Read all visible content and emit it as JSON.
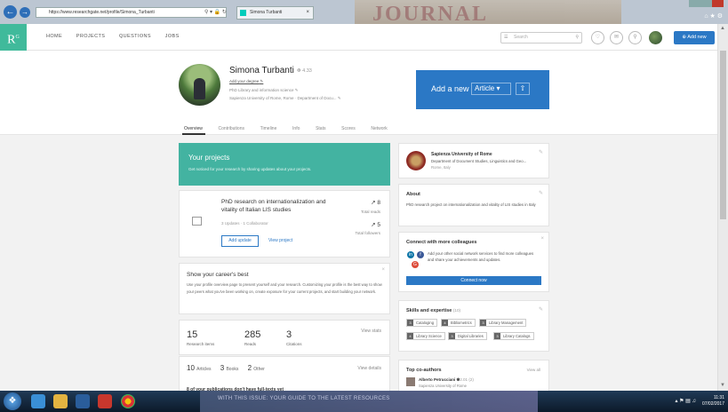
{
  "browser": {
    "url": "https://www.researchgate.net/profile/Simona_Turbanti",
    "tab_title": "Simona Turbanti",
    "background_text": "JOURNAL"
  },
  "header": {
    "logo": "R",
    "logo_sup": "G",
    "nav": [
      "HOME",
      "PROJECTS",
      "QUESTIONS",
      "JOBS"
    ],
    "search_placeholder": "Search",
    "add_new": "Add new"
  },
  "profile": {
    "name": "Simona Turbanti",
    "score": "4.33",
    "degree": "Add your degree",
    "line1": "PhD Library and information science",
    "line2": "Sapienza University of Rome, Rome · Department of Docu..."
  },
  "add_panel": {
    "label": "Add a new",
    "select": "Article"
  },
  "tabs": [
    "Overview",
    "Contributions",
    "Timeline",
    "Info",
    "Stats",
    "Scores",
    "Network"
  ],
  "projects_card": {
    "title": "Your projects",
    "subtitle": "Get noticed for your research by sharing updates about your projects."
  },
  "project": {
    "title": "PhD research on internationalization and vitality of Italian LIS studies",
    "sub": "3 Updates · 1 Collaborator",
    "add_update": "Add update",
    "view_project": "View project",
    "reads": "8",
    "reads_label": "Total reads",
    "followers": "5",
    "followers_label": "Total followers"
  },
  "career": {
    "title": "Show your career's best",
    "desc": "Use your profile overview page to present yourself and your research. Customizing your profile is the best way to show your peers what you've been working on, create exposure for your current projects, and start building your network."
  },
  "stats": {
    "items": [
      {
        "num": "15",
        "label": "Research items"
      },
      {
        "num": "285",
        "label": "Reads"
      },
      {
        "num": "3",
        "label": "Citations"
      }
    ],
    "view": "View stats"
  },
  "pubs": {
    "articles_n": "10",
    "articles": "Articles",
    "books_n": "3",
    "books": "Books",
    "other_n": "2",
    "other": "Other",
    "view": "View details",
    "fulltext": "8 of your publications don't have full-texts yet"
  },
  "institution": {
    "name": "Sapienza University of Rome",
    "dept": "Department of Document Studies, Linguistics and Geo...",
    "loc": "Rome, Italy"
  },
  "about": {
    "title": "About",
    "desc": "PhD research project on internationalization and vitality of LIS studies in Italy"
  },
  "connect": {
    "title": "Connect with more colleagues",
    "desc": "Add your other social network services to find more colleagues and share your achievements and updates.",
    "button": "Connect now"
  },
  "skills": {
    "title": "Skills and expertise",
    "count": "(10)",
    "items": [
      {
        "n": "3",
        "label": "Cataloging"
      },
      {
        "n": "4",
        "label": "Bibliometrics"
      },
      {
        "n": "3",
        "label": "Library Management"
      },
      {
        "n": "4",
        "label": "Library Science"
      },
      {
        "n": "3",
        "label": "Digital Libraries"
      },
      {
        "n": "3",
        "label": "Library Catalogs"
      }
    ]
  },
  "coauthors": {
    "title": "Top co-authors",
    "view": "View all",
    "name": "Alberto Petrucciani",
    "score": "2.01",
    "count": "(2)",
    "aff": "Sapienza University of Rome"
  },
  "taskbar": {
    "banner": "WITH THIS ISSUE: YOUR GUIDE TO THE LATEST RESOURCES",
    "time": "11:31",
    "date": "07/02/2017"
  }
}
